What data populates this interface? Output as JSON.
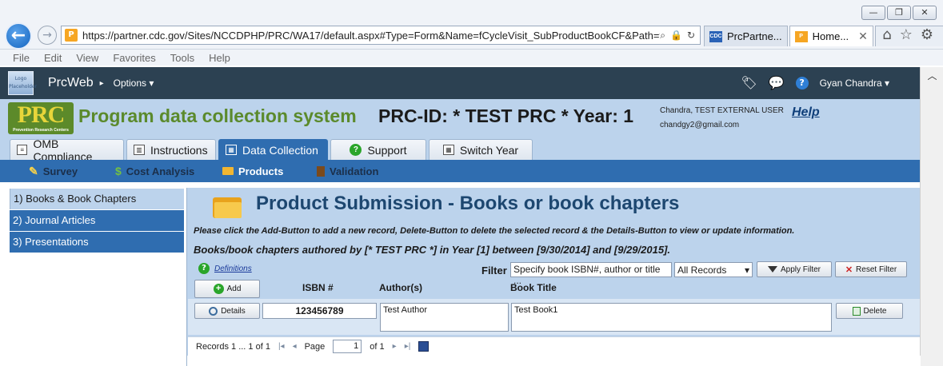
{
  "browser": {
    "url": "https://partner.cdc.gov/Sites/NCCDPHP/PRC/WA17/default.aspx#Type=Form&Name=fCycleVisit_SubProductBookCF&Path=fAdmi",
    "tabs": [
      {
        "label": "PrcPartne...",
        "icon": "cdc-icon"
      },
      {
        "label": "Home...",
        "icon": "prc-favicon-icon"
      }
    ],
    "menu": [
      "File",
      "Edit",
      "View",
      "Favorites",
      "Tools",
      "Help"
    ]
  },
  "app": {
    "logo_text": "Logo Placeholder",
    "name": "PrcWeb",
    "options_label": "Options",
    "user": "Gyan Chandra"
  },
  "header": {
    "logo_text": "PRC",
    "logo_sub": "Prevention Research Centers",
    "system_title": "Program data collection system",
    "prc_id": "PRC-ID: * TEST PRC *  Year: 1",
    "user_line1": "Chandra, TEST EXTERNAL USER",
    "user_line2": "chandgy2@gmail.com",
    "help": "Help"
  },
  "main_tabs": [
    {
      "label": "OMB Compliance"
    },
    {
      "label": "Instructions"
    },
    {
      "label": "Data Collection"
    },
    {
      "label": "Support"
    },
    {
      "label": "Switch Year"
    }
  ],
  "sub_nav": [
    "Survey",
    "Cost Analysis",
    "Products",
    "Validation"
  ],
  "left_menu": [
    "1) Books & Book Chapters",
    "2) Journal Articles",
    "3) Presentations"
  ],
  "content": {
    "title": "Product Submission - Books or book chapters",
    "instructions": "Please click the Add-Button to add a new record, Delete-Button to delete the selected record & the Details-Button to view or update information.",
    "range": "Books/book chapters authored by [* TEST PRC *] in Year [1] between [9/30/2014] and [9/29/2015].",
    "definitions": "Definitions",
    "filter_label": "Filter",
    "filter_placeholder": "Specify book ISBN#, author or title ...",
    "filter_select": "All Records",
    "apply_filter": "Apply Filter",
    "reset_filter": "Reset Filter",
    "add": "Add",
    "columns": [
      "ISBN #",
      "Author(s)",
      "Book Title"
    ],
    "row": {
      "details": "Details",
      "isbn": "123456789",
      "author": "Test Author",
      "title": "Test Book1",
      "delete": "Delete"
    },
    "pager": {
      "records": "Records 1 ... 1 of 1",
      "page_label": "Page",
      "page_value": "1",
      "of_label": "of 1"
    }
  }
}
